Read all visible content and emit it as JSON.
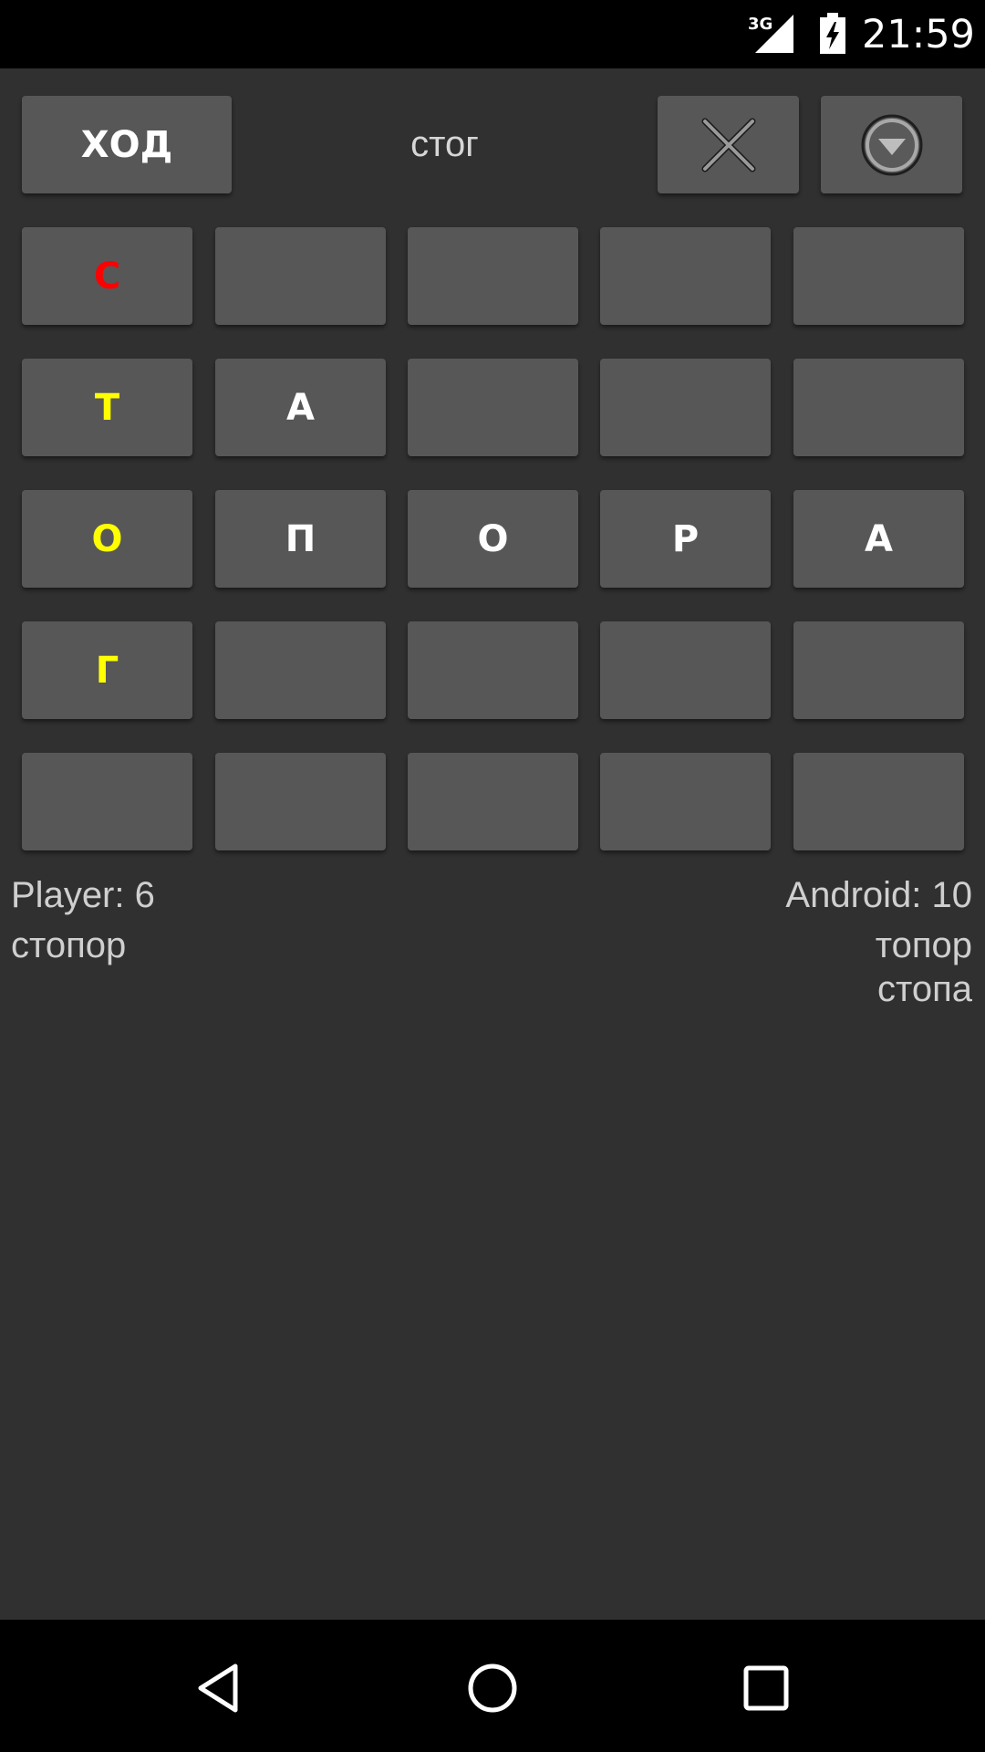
{
  "status_bar": {
    "network": "3G",
    "time": "21:59",
    "signal_icon": "cell-signal-icon",
    "battery_icon": "battery-charging-icon"
  },
  "toolbar": {
    "move_label": "ХОД",
    "current_word": "стог",
    "clear_icon": "close-icon",
    "menu_icon": "dropdown-circle-icon"
  },
  "colors": {
    "background": "#303030",
    "tile": "#575758",
    "selected_first": "#ff0000",
    "selected": "#ffff00",
    "normal": "#ffffff"
  },
  "grid": {
    "rows": [
      [
        {
          "letter": "С",
          "state": "first"
        },
        {
          "letter": "",
          "state": "normal"
        },
        {
          "letter": "",
          "state": "normal"
        },
        {
          "letter": "",
          "state": "normal"
        },
        {
          "letter": "",
          "state": "normal"
        }
      ],
      [
        {
          "letter": "Т",
          "state": "selected"
        },
        {
          "letter": "А",
          "state": "normal"
        },
        {
          "letter": "",
          "state": "normal"
        },
        {
          "letter": "",
          "state": "normal"
        },
        {
          "letter": "",
          "state": "normal"
        }
      ],
      [
        {
          "letter": "О",
          "state": "selected"
        },
        {
          "letter": "П",
          "state": "normal"
        },
        {
          "letter": "О",
          "state": "normal"
        },
        {
          "letter": "Р",
          "state": "normal"
        },
        {
          "letter": "А",
          "state": "normal"
        }
      ],
      [
        {
          "letter": "Г",
          "state": "selected"
        },
        {
          "letter": "",
          "state": "normal"
        },
        {
          "letter": "",
          "state": "normal"
        },
        {
          "letter": "",
          "state": "normal"
        },
        {
          "letter": "",
          "state": "normal"
        }
      ],
      [
        {
          "letter": "",
          "state": "normal"
        },
        {
          "letter": "",
          "state": "normal"
        },
        {
          "letter": "",
          "state": "normal"
        },
        {
          "letter": "",
          "state": "normal"
        },
        {
          "letter": "",
          "state": "normal"
        }
      ]
    ]
  },
  "player": {
    "score_label": "Player: 6",
    "words": [
      "стопор"
    ]
  },
  "android": {
    "score_label": "Android: 10",
    "words": [
      "топор",
      "стопа"
    ]
  },
  "nav_bar": {
    "back_icon": "back-triangle-icon",
    "home_icon": "home-circle-icon",
    "recents_icon": "recents-square-icon"
  }
}
